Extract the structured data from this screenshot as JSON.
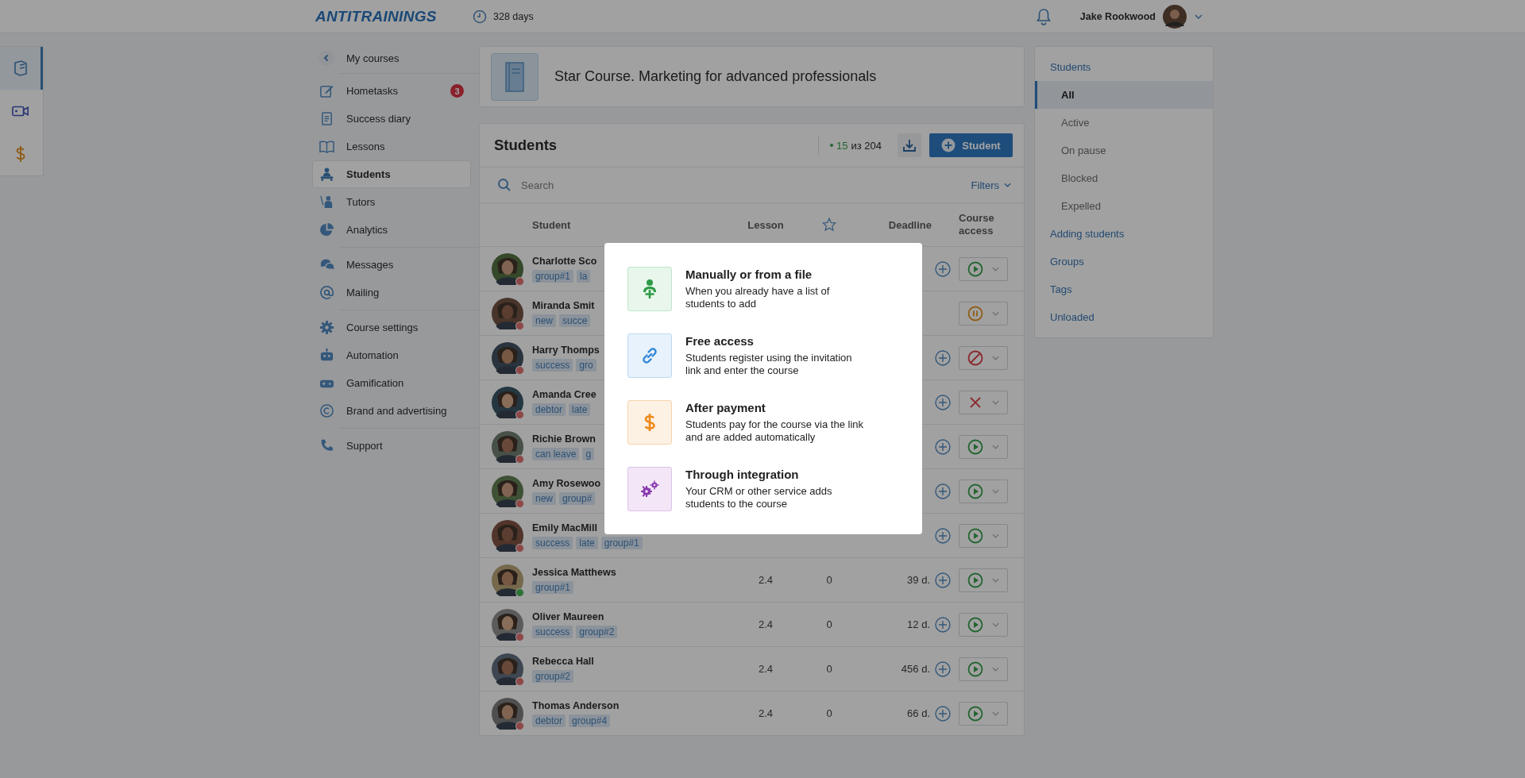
{
  "header": {
    "logo": "ANTITRAININGS",
    "days": "328 days",
    "user_name": "Jake Rookwood"
  },
  "rail": [
    {
      "kind": "courses",
      "selected": true
    },
    {
      "kind": "video",
      "selected": false
    },
    {
      "kind": "money",
      "selected": false
    }
  ],
  "nav": {
    "back": "My courses",
    "sections": [
      [
        {
          "kind": "edit",
          "label": "Hometasks",
          "badge": "3",
          "selected": false
        },
        {
          "kind": "diary",
          "label": "Success diary",
          "selected": false
        },
        {
          "kind": "book",
          "label": "Lessons",
          "selected": false
        },
        {
          "kind": "students",
          "label": "Students",
          "selected": true
        },
        {
          "kind": "tutors",
          "label": "Tutors",
          "selected": false
        },
        {
          "kind": "analytics",
          "label": "Analytics",
          "selected": false
        }
      ],
      [
        {
          "kind": "messages",
          "label": "Messages",
          "selected": false
        },
        {
          "kind": "mailing",
          "label": "Mailing",
          "selected": false
        }
      ],
      [
        {
          "kind": "gear",
          "label": "Course settings",
          "selected": false
        },
        {
          "kind": "robot",
          "label": "Automation",
          "selected": false
        },
        {
          "kind": "gamepad",
          "label": "Gamification",
          "selected": false
        },
        {
          "kind": "copyright",
          "label": "Brand and advertising",
          "selected": false
        }
      ],
      [
        {
          "kind": "phone",
          "label": "Support",
          "selected": false
        }
      ]
    ]
  },
  "course": {
    "title": "Star Course. Marketing for advanced professionals"
  },
  "students": {
    "title": "Students",
    "count_active": "15",
    "count_total": "из 204",
    "add_button": "Student",
    "search": {
      "placeholder": "Search"
    },
    "filters": "Filters",
    "columns": {
      "student": "Student",
      "lesson": "Lesson",
      "deadline": "Deadline",
      "access": "Course access"
    },
    "rows": [
      {
        "name": "Charlotte Sco",
        "tags": [
          "group#1",
          "la"
        ],
        "color": "#8e4949",
        "can_extend": true,
        "access": {
          "kind": "active"
        }
      },
      {
        "name": "Miranda Smit",
        "tags": [
          "new",
          "succe"
        ],
        "color": "#8e4949",
        "can_extend": false,
        "access": {
          "kind": "paused"
        }
      },
      {
        "name": "Harry Thomps",
        "tags": [
          "success",
          "gro"
        ],
        "color": "#8e4949",
        "can_extend": true,
        "access": {
          "kind": "blocked"
        }
      },
      {
        "name": "Amanda Cree",
        "tags": [
          "debtor",
          "late"
        ],
        "color": "#8e4949",
        "can_extend": true,
        "access": {
          "kind": "expelled"
        }
      },
      {
        "name": "Richie Brown",
        "tags": [
          "can leave",
          "g"
        ],
        "color": "#8e4949",
        "can_extend": true,
        "access": {
          "kind": "active"
        }
      },
      {
        "name": "Amy Rosewoo",
        "tags": [
          "new",
          "group#"
        ],
        "color": "#8e4949",
        "can_extend": true,
        "access": {
          "kind": "active"
        }
      },
      {
        "name": "Emily MacMill",
        "tags": [
          "success",
          "late",
          "group#1"
        ],
        "color": "#8e4949",
        "can_extend": true,
        "access": {
          "kind": "active"
        }
      },
      {
        "name": "Jessica Matthews",
        "tags": [
          "group#1"
        ],
        "color": "#2e7337",
        "lesson": "2.4",
        "rating": "0",
        "deadline": "39 d.",
        "can_extend": true,
        "access": {
          "kind": "active"
        }
      },
      {
        "name": "Oliver Maureen",
        "tags": [
          "success",
          "group#2"
        ],
        "color": "#8e4949",
        "lesson": "2.4",
        "rating": "0",
        "deadline": "12 d.",
        "can_extend": true,
        "access": {
          "kind": "active"
        }
      },
      {
        "name": "Rebecca Hall",
        "tags": [
          "group#2"
        ],
        "color": "#8e4949",
        "lesson": "2.4",
        "rating": "0",
        "deadline": "456 d.",
        "can_extend": true,
        "access": {
          "kind": "active"
        }
      },
      {
        "name": "Thomas Anderson",
        "tags": [
          "debtor",
          "group#4"
        ],
        "color": "#8e4949",
        "lesson": "2.4",
        "rating": "0",
        "deadline": "66 d.",
        "can_extend": true,
        "access": {
          "kind": "active"
        }
      }
    ]
  },
  "side_menu": [
    {
      "label": "Students",
      "selected": false,
      "children": [
        {
          "label": "All",
          "selected": true
        },
        {
          "label": "Active",
          "selected": false
        },
        {
          "label": "On pause",
          "selected": false
        },
        {
          "label": "Blocked",
          "selected": false
        },
        {
          "label": "Expelled",
          "selected": false
        }
      ]
    },
    {
      "label": "Adding students",
      "selected": false
    },
    {
      "label": "Groups",
      "selected": false
    },
    {
      "label": "Tags",
      "selected": false
    },
    {
      "label": "Unloaded",
      "selected": false
    }
  ],
  "modal": {
    "options": [
      {
        "kind": "manual",
        "title": "Manually or from a file",
        "description": "When you already have a list of students to add"
      },
      {
        "kind": "link",
        "title": "Free access",
        "description": "Students register using the invitation link and enter the course"
      },
      {
        "kind": "payment",
        "title": "After payment",
        "description": "Students pay for the course via the link and are added automatically"
      },
      {
        "kind": "integration",
        "title": "Through integration",
        "description": "Your CRM or other service adds students to the course"
      }
    ]
  }
}
